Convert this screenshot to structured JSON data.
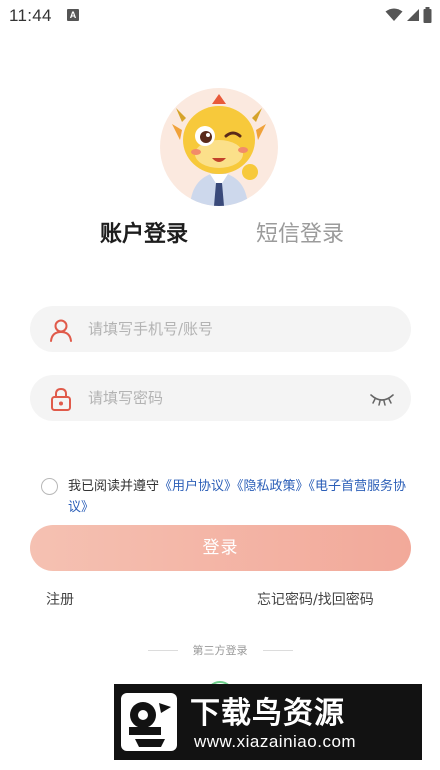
{
  "status_bar": {
    "time": "11:44",
    "notification_letter": "A",
    "icons": [
      "wifi-icon",
      "signal-icon",
      "battery-icon"
    ]
  },
  "avatar": {
    "icon": "dragon-mascot-avatar"
  },
  "tabs": [
    {
      "label": "账户登录",
      "active": true
    },
    {
      "label": "短信登录",
      "active": false
    }
  ],
  "form": {
    "phone": {
      "placeholder": "请填写手机号/账号",
      "value": "",
      "icon": "user-icon"
    },
    "password": {
      "placeholder": "请填写密码",
      "value": "",
      "icon": "lock-icon",
      "toggle_icon": "eye-closed-icon"
    }
  },
  "agreement": {
    "checked": false,
    "prefix": "我已阅读并遵守",
    "links": [
      "《用户协议》",
      "《隐私政策》",
      "《电子首营服务协议》"
    ]
  },
  "login_button": {
    "label": "登录"
  },
  "links": {
    "register": "注册",
    "forgot": "忘记密码/找回密码"
  },
  "third_party": {
    "label": "第三方登录"
  },
  "watermark": {
    "title": "下载鸟资源",
    "url": "www.xiazainiao.com"
  },
  "colors": {
    "accent": "#e05a4a",
    "button_start": "#f5c1b2",
    "button_end": "#f2a99a",
    "link": "#2c5fb8",
    "input_bg": "#f4f4f4"
  }
}
